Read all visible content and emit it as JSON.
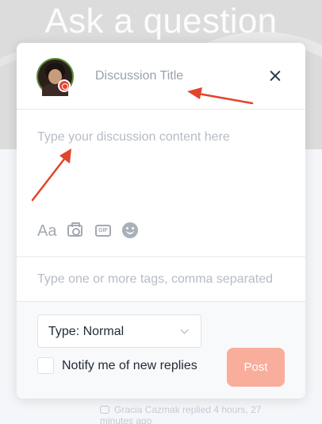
{
  "background": {
    "heading": "Ask a question",
    "footer_note": "Gracia Cazmak replied 4 hours, 27 minutes ago"
  },
  "modal": {
    "title_placeholder": "Discussion Title",
    "content_placeholder": "Type your discussion content here",
    "toolbar": {
      "text_format": "Aa",
      "gif": "GIF"
    },
    "tags_placeholder": "Type one or more tags, comma separated",
    "type_select": "Type: Normal",
    "notify_label": "Notify me of new replies",
    "post_label": "Post"
  },
  "colors": {
    "post_button": "#f9ad9b",
    "annotation_arrow": "#e2452c"
  }
}
